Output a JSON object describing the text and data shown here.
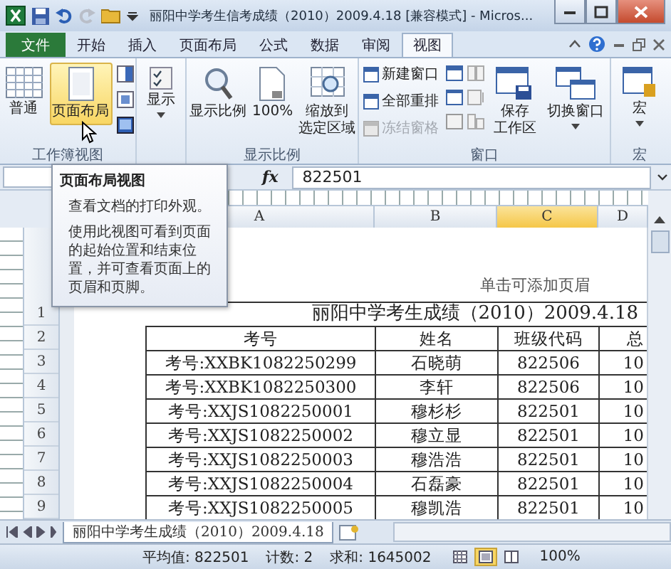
{
  "window": {
    "title": "丽阳中学考生信考成绩（2010）2009.4.18 [兼容模式] - Micros..."
  },
  "tabs": [
    {
      "label": "文件",
      "kind": "file",
      "selected": false
    },
    {
      "label": "开始",
      "kind": "tab",
      "selected": false
    },
    {
      "label": "插入",
      "kind": "tab",
      "selected": false
    },
    {
      "label": "页面布局",
      "kind": "tab",
      "selected": false
    },
    {
      "label": "公式",
      "kind": "tab",
      "selected": false
    },
    {
      "label": "数据",
      "kind": "tab",
      "selected": false
    },
    {
      "label": "审阅",
      "kind": "tab",
      "selected": false
    },
    {
      "label": "视图",
      "kind": "tab",
      "selected": true
    }
  ],
  "ribbon": {
    "workbook_views": {
      "label": "工作簿视图",
      "buttons": [
        {
          "label": "普通",
          "selected": false
        },
        {
          "label": "页面布局",
          "selected": true
        }
      ]
    },
    "show": {
      "label": "显示"
    },
    "zoom": {
      "label": "显示比例",
      "buttons": [
        {
          "lines": [
            "显示比例"
          ]
        },
        {
          "lines": [
            "100%"
          ]
        },
        {
          "lines": [
            "缩放到",
            "选定区域"
          ]
        }
      ]
    },
    "window": {
      "label": "窗口",
      "commands": [
        {
          "label": "新建窗口",
          "disabled": false
        },
        {
          "label": "全部重排",
          "disabled": false
        },
        {
          "label": "冻结窗格",
          "disabled": true
        }
      ],
      "buttons": [
        {
          "lines": [
            "保存",
            "工作区"
          ]
        },
        {
          "lines": [
            "切换窗口"
          ]
        }
      ]
    },
    "macros": {
      "label": "宏",
      "button": "宏"
    }
  },
  "formula_bar": {
    "fx": "fx",
    "value": "822501"
  },
  "column_headers": [
    {
      "label": "A",
      "selected": false
    },
    {
      "label": "B",
      "selected": false
    },
    {
      "label": "C",
      "selected": true
    },
    {
      "label": "D",
      "selected": false
    }
  ],
  "row_headers": [
    "1",
    "2",
    "3",
    "4",
    "5",
    "6",
    "7",
    "8",
    "9"
  ],
  "page": {
    "header_hint": "单击可添加页眉",
    "title": "丽阳中学考生成绩（2010）2009.4.18",
    "columns": [
      "考号",
      "姓名",
      "班级代码",
      "总"
    ],
    "rows": [
      [
        "考号:XXBK1082250299",
        "石晓萌",
        "822506",
        "10"
      ],
      [
        "考号:XXBK1082250300",
        "李轩",
        "822506",
        "10"
      ],
      [
        "考号:XXJS1082250001",
        "穆杉杉",
        "822501",
        "10"
      ],
      [
        "考号:XXJS1082250002",
        "穆立显",
        "822501",
        "10"
      ],
      [
        "考号:XXJS1082250003",
        "穆浩浩",
        "822501",
        "10"
      ],
      [
        "考号:XXJS1082250004",
        "石磊豪",
        "822501",
        "10"
      ],
      [
        "考号:XXJS1082250005",
        "穆凯浩",
        "822501",
        "10"
      ]
    ]
  },
  "tooltip": {
    "title": "页面布局视图",
    "lines": [
      "查看文档的打印外观。",
      "使用此视图可看到页面的起始位置和结束位置，并可查看页面上的页眉和页脚。"
    ]
  },
  "sheet_tab": {
    "label": "丽阳中学考生成绩（2010）2009.4.18",
    "selected": true
  },
  "status_bar": {
    "items": [
      "平均值: 822501",
      "计数: 2",
      "求和: 1645002"
    ],
    "views": [
      {
        "selected": false
      },
      {
        "selected": true
      },
      {
        "selected": false
      }
    ],
    "zoom": "100%"
  }
}
